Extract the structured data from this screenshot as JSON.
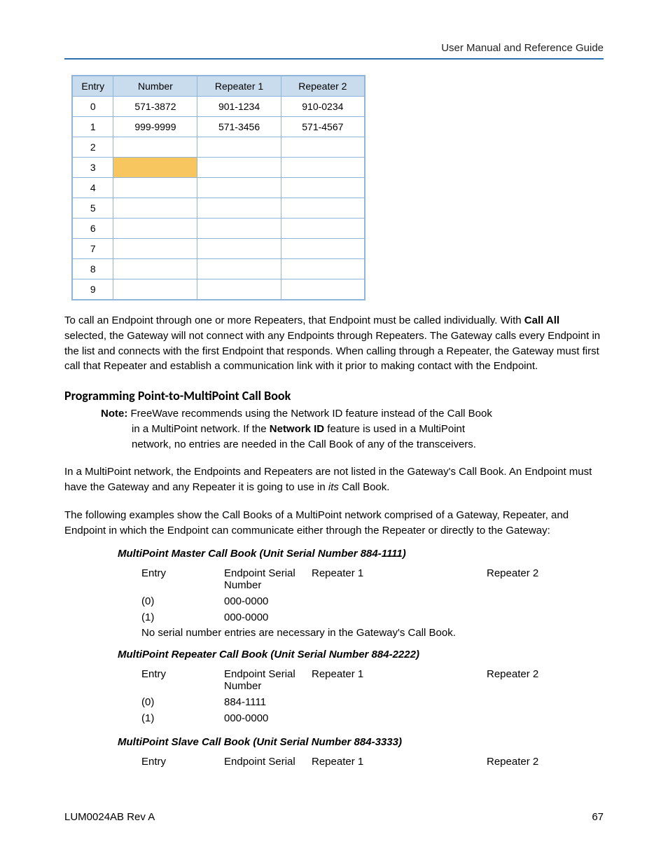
{
  "header": {
    "title": "User Manual and Reference Guide"
  },
  "shot_table": {
    "headers": [
      "Entry",
      "Number",
      "Repeater 1",
      "Repeater 2"
    ],
    "rows": [
      {
        "entry": "0",
        "number": "571-3872",
        "r1": "901-1234",
        "r2": "910-0234",
        "hl": false
      },
      {
        "entry": "1",
        "number": "999-9999",
        "r1": "571-3456",
        "r2": "571-4567",
        "hl": false
      },
      {
        "entry": "2",
        "number": "",
        "r1": "",
        "r2": "",
        "hl": false
      },
      {
        "entry": "3",
        "number": "",
        "r1": "",
        "r2": "",
        "hl": true
      },
      {
        "entry": "4",
        "number": "",
        "r1": "",
        "r2": "",
        "hl": false
      },
      {
        "entry": "5",
        "number": "",
        "r1": "",
        "r2": "",
        "hl": false
      },
      {
        "entry": "6",
        "number": "",
        "r1": "",
        "r2": "",
        "hl": false
      },
      {
        "entry": "7",
        "number": "",
        "r1": "",
        "r2": "",
        "hl": false
      },
      {
        "entry": "8",
        "number": "",
        "r1": "",
        "r2": "",
        "hl": false
      },
      {
        "entry": "9",
        "number": "",
        "r1": "",
        "r2": "",
        "hl": false
      }
    ]
  },
  "para1": {
    "pre": "To call an Endpoint through one or more Repeaters, that Endpoint must be called individually. With ",
    "bold": "Call All",
    "post": " selected, the Gateway will not connect with any Endpoints through Repeaters. The Gateway calls every Endpoint in the list and connects with the first Endpoint that responds. When calling through a Repeater, the Gateway must first call that Repeater and establish a communication link with it prior to making contact with the Endpoint."
  },
  "subhead": "Programming Point-to-MultiPoint Call Book",
  "note": {
    "label": "Note: ",
    "line1a": "FreeWave recommends using the Network ID feature instead of the Call Book",
    "line1b": "in a MultiPoint network. If the ",
    "bold": "Network ID",
    "line1c": " feature is used in a MultiPoint",
    "line2": "network, no entries are needed in the Call Book of any of the transceivers."
  },
  "para2": {
    "pre": "In a MultiPoint network, the Endpoints and Repeaters are not listed in the Gateway's Call Book. An Endpoint must have the Gateway and any Repeater it is going to use in ",
    "ital": "its",
    "post": " Call Book."
  },
  "para3": "The following examples show the Call Books of a MultiPoint network comprised of a Gateway, Repeater, and Endpoint in which the Endpoint can communicate either through the Repeater or directly to the Gateway:",
  "sections": [
    {
      "title": "MultiPoint Master Call Book (Unit Serial Number 884-1111)",
      "headers": [
        "Entry",
        "Endpoint Serial Number",
        "Repeater 1",
        "Repeater 2"
      ],
      "rows": [
        {
          "entry": "(0)",
          "sn": "000-0000",
          "r1": "",
          "r2": ""
        },
        {
          "entry": "(1)",
          "sn": "000-0000",
          "r1": "",
          "r2": ""
        }
      ],
      "note": "No serial number entries are necessary in the Gateway's Call Book."
    },
    {
      "title": "MultiPoint Repeater Call Book (Unit Serial Number 884-2222)",
      "headers": [
        "Entry",
        "Endpoint Serial Number",
        "Repeater 1",
        "Repeater 2"
      ],
      "rows": [
        {
          "entry": "(0)",
          "sn": "884-1111",
          "r1": "",
          "r2": ""
        },
        {
          "entry": "(1)",
          "sn": "000-0000",
          "r1": "",
          "r2": ""
        }
      ],
      "note": ""
    },
    {
      "title": "MultiPoint Slave Call Book (Unit Serial Number 884-3333)",
      "headers": [
        "Entry",
        "Endpoint Serial",
        "Repeater 1",
        "Repeater 2"
      ],
      "rows": [],
      "note": ""
    }
  ],
  "footer": {
    "left": "LUM0024AB Rev A",
    "right": "67"
  }
}
